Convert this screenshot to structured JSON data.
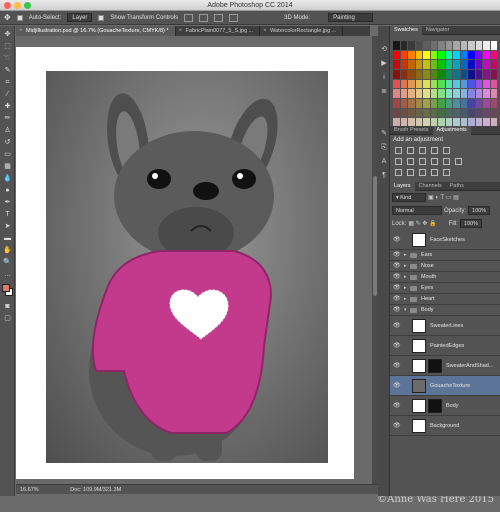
{
  "window": {
    "title": "Adobe Photoshop CC 2014"
  },
  "options_bar": {
    "auto_select_label": "Auto-Select:",
    "auto_select_value": "Layer",
    "show_transform_label": "Show Transform Controls",
    "mode_3d_label": "3D Mode:",
    "workspace_value": "Painting"
  },
  "tabs": [
    {
      "label": "MidjIllustration.psd @ 16.7% (GouacheTexture, CMYK/8) *",
      "active": true
    },
    {
      "label": "FabricPlain0077_5_S.jpg ...",
      "active": false
    },
    {
      "label": "WatercolorRectangle.jpg ...",
      "active": false
    }
  ],
  "status": {
    "zoom": "16.67%",
    "doc": "Doc: 109.9M/321.3M"
  },
  "watermark": "©Anne Was Here 2015",
  "colors": {
    "foreground": "#e07a6e",
    "background": "#ffffff",
    "sweater": "#c33a8c",
    "heart": "#ffffff",
    "selection": "#5c7497"
  },
  "panels": {
    "swatches_tabs": [
      "Swatches",
      "Navigator"
    ],
    "adjust_tabs": [
      "Brush Presets",
      "Adjustments"
    ],
    "adjust_title": "Add an adjustment",
    "layers_tabs": [
      "Layers",
      "Channels",
      "Paths"
    ],
    "kind_label": "Kind",
    "blend_mode": "Normal",
    "opacity_label": "Opacity:",
    "opacity_value": "100%",
    "lock_label": "Lock:",
    "fill_label": "Fill:",
    "fill_value": "100%"
  },
  "layers": [
    {
      "name": "FaceSketches",
      "kind": "pixel"
    },
    {
      "name": "Ears",
      "kind": "group"
    },
    {
      "name": "Nose",
      "kind": "group"
    },
    {
      "name": "Mouth",
      "kind": "group"
    },
    {
      "name": "Eyes",
      "kind": "group"
    },
    {
      "name": "Heart",
      "kind": "group"
    },
    {
      "name": "Body",
      "kind": "group-open"
    },
    {
      "name": "SweaterLines",
      "kind": "pixel"
    },
    {
      "name": "PaintedEdges",
      "kind": "pixel"
    },
    {
      "name": "SweaterAndShad...",
      "kind": "fx"
    },
    {
      "name": "GouacheTexture",
      "kind": "pixel-selected"
    },
    {
      "name": "Body",
      "kind": "masked"
    },
    {
      "name": "Background",
      "kind": "background"
    }
  ]
}
